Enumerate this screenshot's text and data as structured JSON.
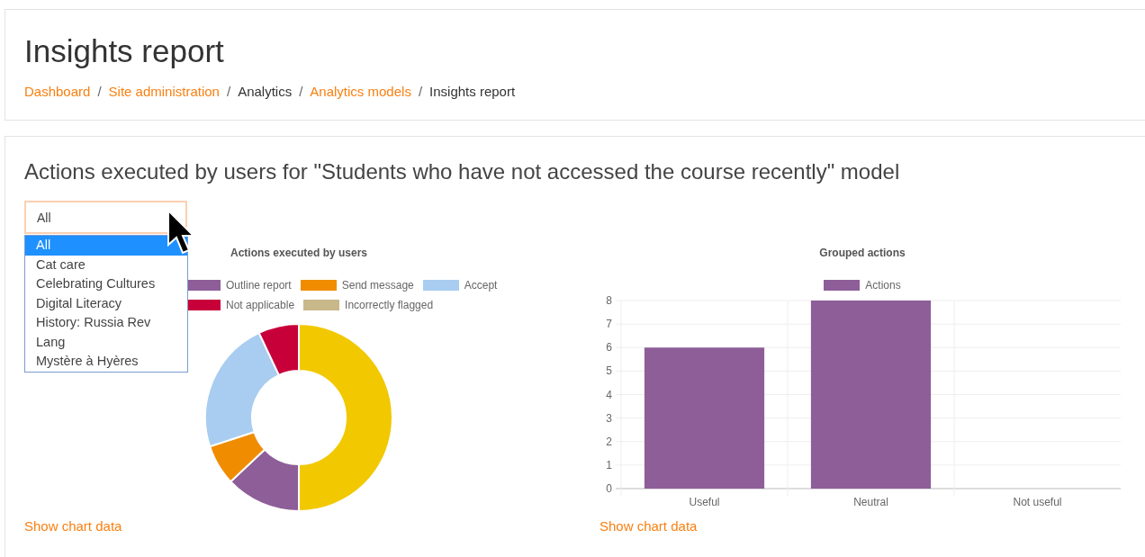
{
  "header": {
    "title": "Insights report",
    "separator": "/",
    "breadcrumb": [
      {
        "label": "Dashboard",
        "link": true
      },
      {
        "label": "Site administration",
        "link": true
      },
      {
        "label": "Analytics",
        "link": false
      },
      {
        "label": "Analytics models",
        "link": true
      },
      {
        "label": "Insights report",
        "link": false
      }
    ]
  },
  "report": {
    "heading": "Actions executed by users for \"Students who have not accessed the course recently\" model",
    "course_select": {
      "value": "All",
      "expanded": true,
      "options": [
        {
          "label": "All",
          "selected": true
        },
        {
          "label": "Cat care",
          "selected": false
        },
        {
          "label": "Celebrating Cultures",
          "selected": false
        },
        {
          "label": "Digital Literacy",
          "selected": false
        },
        {
          "label": "History: Russia Rev",
          "selected": false
        },
        {
          "label": "Lang",
          "selected": false
        },
        {
          "label": "Mystère à Hyères",
          "selected": false
        }
      ]
    },
    "donut_chart": {
      "kind": "picture",
      "title": "Actions executed by users",
      "legend": [
        {
          "label": "Outline report",
          "color": "#8e5e99"
        },
        {
          "label": "Send message",
          "color": "#f08c00"
        },
        {
          "label": "Accept",
          "color": "#a8cdf0"
        },
        {
          "label": "Not applicable",
          "color": "#c8003a"
        },
        {
          "label": "Incorrectly flagged",
          "color": "#c8b88a"
        }
      ],
      "link": "Show chart data"
    },
    "bar_chart": {
      "link": "Show chart data",
      "chart_data": {
        "type": "bar",
        "title": "Grouped actions",
        "categories": [
          "Useful",
          "Neutral",
          "Not useful"
        ],
        "series": [
          {
            "name": "Actions",
            "color": "#8e5e99",
            "values": [
              6,
              8,
              0
            ]
          }
        ],
        "grid": true,
        "ylim": [
          0,
          8
        ],
        "yticks": [
          0,
          1,
          2,
          3,
          4,
          5,
          6,
          7,
          8
        ]
      }
    }
  }
}
